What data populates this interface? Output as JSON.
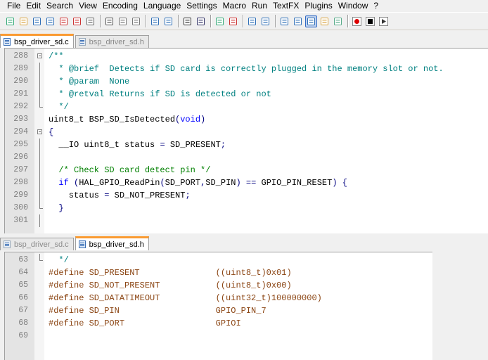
{
  "menu": [
    "File",
    "Edit",
    "Search",
    "View",
    "Encoding",
    "Language",
    "Settings",
    "Macro",
    "Run",
    "TextFX",
    "Plugins",
    "Window",
    "?"
  ],
  "toolbar_icons": [
    "new-file",
    "open-file",
    "save",
    "save-all",
    "close",
    "close-all",
    "print",
    "cut",
    "copy",
    "paste",
    "undo",
    "redo",
    "find",
    "replace",
    "zoom-in",
    "zoom-out",
    "sync-vertical",
    "sync-horizontal",
    "word-wrap",
    "show-all-chars",
    "indent-guide",
    "user-lang",
    "doc-map",
    "record-macro",
    "stop-record",
    "play-macro"
  ],
  "top_tabs": [
    {
      "label": "bsp_driver_sd.c",
      "active": true
    },
    {
      "label": "bsp_driver_sd.h",
      "active": false
    }
  ],
  "bottom_tabs": [
    {
      "label": "bsp_driver_sd.c",
      "active": false
    },
    {
      "label": "bsp_driver_sd.h",
      "active": true
    }
  ],
  "top_lines": [
    {
      "n": "288",
      "fold": "box",
      "parts": [
        [
          "c-comment",
          "/**"
        ]
      ]
    },
    {
      "n": "289",
      "fold": "vl",
      "parts": [
        [
          "c-comment",
          "  * @brief  Detects if SD card is correctly plugged in the memory slot or not."
        ]
      ]
    },
    {
      "n": "290",
      "fold": "vl",
      "parts": [
        [
          "c-comment",
          "  * @param  None"
        ]
      ]
    },
    {
      "n": "291",
      "fold": "vl",
      "parts": [
        [
          "c-comment",
          "  * @retval Returns if SD is detected or not"
        ]
      ]
    },
    {
      "n": "292",
      "fold": "end",
      "parts": [
        [
          "c-comment",
          "  */"
        ]
      ]
    },
    {
      "n": "293",
      "fold": "",
      "parts": [
        [
          "",
          "uint8_t BSP_SD_IsDetected"
        ],
        [
          "c-op",
          "("
        ],
        [
          "c-kw",
          "void"
        ],
        [
          "c-op",
          ")"
        ]
      ]
    },
    {
      "n": "294",
      "fold": "box",
      "parts": [
        [
          "c-op",
          "{"
        ]
      ]
    },
    {
      "n": "295",
      "fold": "vl",
      "parts": [
        [
          "",
          "  __IO uint8_t status "
        ],
        [
          "c-op",
          "="
        ],
        [
          "",
          " SD_PRESENT"
        ],
        [
          "c-op",
          ";"
        ]
      ]
    },
    {
      "n": "296",
      "fold": "vl",
      "parts": [
        [
          "",
          ""
        ]
      ]
    },
    {
      "n": "297",
      "fold": "vl",
      "parts": [
        [
          "c-cmt",
          "  /* Check SD card detect pin */"
        ]
      ]
    },
    {
      "n": "298",
      "fold": "vl",
      "parts": [
        [
          "c-kw",
          "  if"
        ],
        [
          "",
          " "
        ],
        [
          "c-op",
          "("
        ],
        [
          "",
          "HAL_GPIO_ReadPin"
        ],
        [
          "c-op",
          "("
        ],
        [
          "",
          "SD_PORT"
        ],
        [
          "c-op",
          ","
        ],
        [
          "",
          "SD_PIN"
        ],
        [
          "c-op",
          ")"
        ],
        [
          "",
          " "
        ],
        [
          "c-op",
          "=="
        ],
        [
          "",
          " GPIO_PIN_RESET"
        ],
        [
          "c-op",
          ")"
        ],
        [
          "",
          " "
        ],
        [
          "c-op",
          "{"
        ]
      ]
    },
    {
      "n": "299",
      "fold": "vl",
      "parts": [
        [
          "",
          "    status "
        ],
        [
          "c-op",
          "="
        ],
        [
          "",
          " SD_NOT_PRESENT"
        ],
        [
          "c-op",
          ";"
        ]
      ]
    },
    {
      "n": "300",
      "fold": "end",
      "parts": [
        [
          "c-op",
          "  }"
        ]
      ]
    },
    {
      "n": "301",
      "fold": "vl",
      "parts": [
        [
          "",
          ""
        ]
      ]
    }
  ],
  "bottom_lines": [
    {
      "n": "63",
      "fold": "end",
      "parts": [
        [
          "c-comment",
          "  */"
        ]
      ]
    },
    {
      "n": "64",
      "fold": "",
      "parts": [
        [
          "c-def",
          "#define SD_PRESENT               ((uint8_t)0x01)"
        ]
      ]
    },
    {
      "n": "65",
      "fold": "",
      "parts": [
        [
          "c-def",
          "#define SD_NOT_PRESENT           ((uint8_t)0x00)"
        ]
      ]
    },
    {
      "n": "66",
      "fold": "",
      "parts": [
        [
          "c-def",
          "#define SD_DATATIMEOUT           ((uint32_t)100000000)"
        ]
      ]
    },
    {
      "n": "67",
      "fold": "",
      "parts": [
        [
          "c-def",
          "#define SD_PIN                   GPIO_PIN_7"
        ]
      ]
    },
    {
      "n": "68",
      "fold": "",
      "parts": [
        [
          "c-def",
          "#define SD_PORT                  GPIOI"
        ]
      ]
    },
    {
      "n": "69",
      "fold": "",
      "parts": [
        [
          "",
          ""
        ]
      ]
    }
  ]
}
